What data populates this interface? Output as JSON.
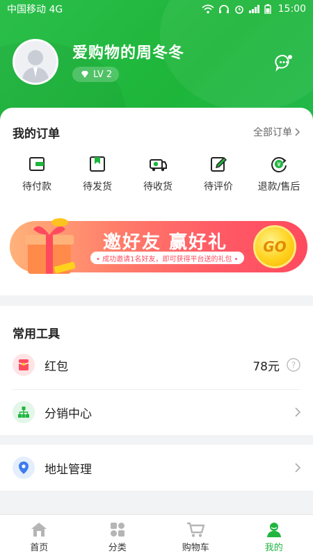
{
  "status_bar": {
    "carrier": "中国移动 4G",
    "time": "15:00"
  },
  "profile": {
    "username": "爱购物的周冬冬",
    "level": "LV 2"
  },
  "orders": {
    "title": "我的订单",
    "all_label": "全部订单",
    "items": [
      {
        "label": "待付款",
        "icon": "wallet-icon"
      },
      {
        "label": "待发货",
        "icon": "package-icon"
      },
      {
        "label": "待收货",
        "icon": "truck-icon"
      },
      {
        "label": "待评价",
        "icon": "edit-icon"
      },
      {
        "label": "退款/售后",
        "icon": "refund-icon"
      }
    ]
  },
  "banner": {
    "title": "邀好友 赢好礼",
    "subtitle": "• 成功邀请1名好友，即可获得平台送的礼包 •",
    "button": "GO"
  },
  "tools": {
    "title": "常用工具",
    "items": [
      {
        "label": "红包",
        "value": "78元",
        "icon": "red-packet-icon"
      },
      {
        "label": "分销中心",
        "icon": "distribution-icon"
      }
    ]
  },
  "address": {
    "label": "地址管理",
    "icon": "location-icon"
  },
  "tabbar": {
    "items": [
      {
        "label": "首页",
        "icon": "home-icon"
      },
      {
        "label": "分类",
        "icon": "category-icon"
      },
      {
        "label": "购物车",
        "icon": "cart-icon"
      },
      {
        "label": "我的",
        "icon": "user-icon"
      }
    ],
    "active_index": 3
  },
  "colors": {
    "brand": "#1fb53f",
    "banner": "#ff5a66",
    "bg": "#f2f3f5"
  }
}
